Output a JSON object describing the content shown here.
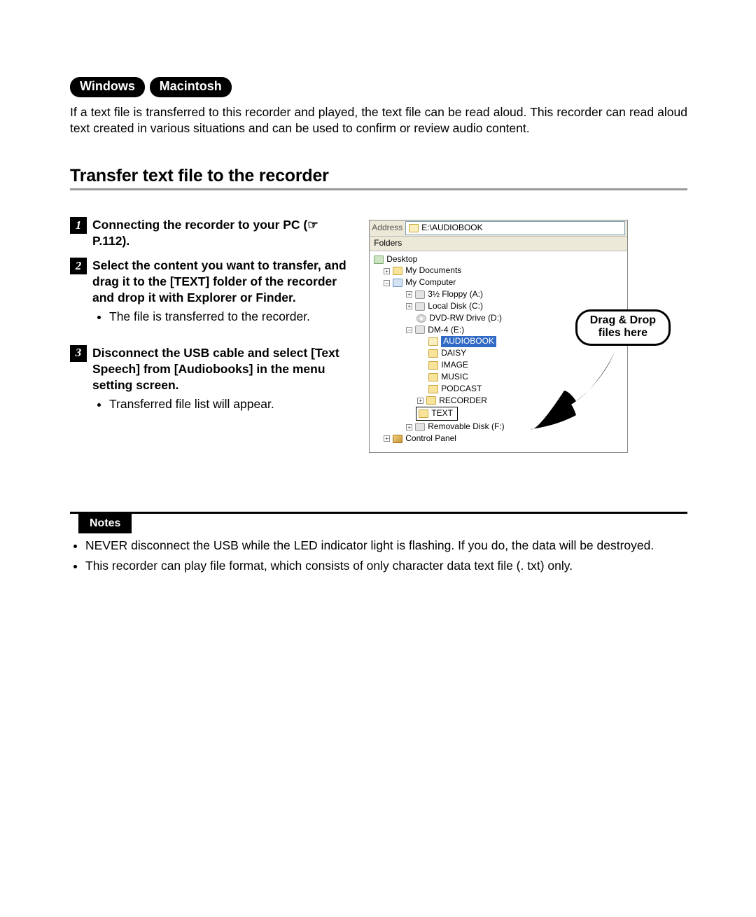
{
  "os_pills": [
    "Windows",
    "Macintosh"
  ],
  "intro": "If a text file is transferred to this recorder and played, the text file can be read aloud. This recorder can read aloud text created in various situations and can be used to confirm or review audio content.",
  "section_title": "Transfer text file to the recorder",
  "steps": [
    {
      "num": "1",
      "title_pre": "Connecting the recorder to your PC (☞ P.112).",
      "sub": []
    },
    {
      "num": "2",
      "title_pre": "Select the content you want to transfer, and drag it to the [",
      "title_bold": "TEXT",
      "title_post": "] folder of the recorder and drop it with Explorer or Finder.",
      "sub": [
        "The file is transferred to the recorder."
      ]
    },
    {
      "num": "3",
      "title_pre": "Disconnect the USB cable and select [",
      "title_bold": "Text Speech",
      "title_mid": "] from [",
      "title_bold2": "Audiobooks",
      "title_post": "] in the menu setting screen.",
      "sub": [
        "Transferred file list will appear."
      ]
    }
  ],
  "explorer": {
    "address_label": "Address",
    "address_value": "E:\\AUDIOBOOK",
    "folders_label": "Folders",
    "tree": {
      "desktop": "Desktop",
      "my_documents": "My Documents",
      "my_computer": "My Computer",
      "floppy": "3½ Floppy (A:)",
      "local_disk": "Local Disk (C:)",
      "dvd": "DVD-RW Drive (D:)",
      "dm4": "DM-4 (E:)",
      "audiobook": "AUDIOBOOK",
      "daisy": "DAISY",
      "image": "IMAGE",
      "music": "MUSIC",
      "podcast": "PODCAST",
      "recorder": "RECORDER",
      "text": "TEXT",
      "removable": "Removable Disk (F:)",
      "control_panel": "Control Panel"
    }
  },
  "callout": {
    "line1": "Drag & Drop",
    "line2": "files here"
  },
  "notes": {
    "label": "Notes",
    "items": [
      "NEVER disconnect the USB while the LED indicator light is flashing. If you do, the data will be destroyed.",
      "This recorder can play file format, which consists of only character data text file (. txt) only."
    ]
  }
}
